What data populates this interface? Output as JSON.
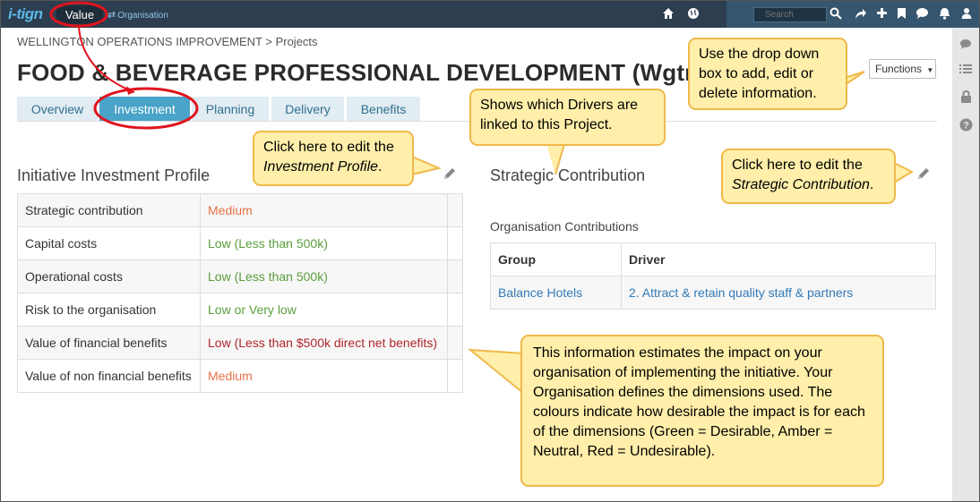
{
  "topbar": {
    "logo": "i-tign",
    "value_label": "Value",
    "organisation_label": "Organisation",
    "search_placeholder": "Search"
  },
  "breadcrumb": "WELLINGTON OPERATIONS IMPROVEMENT > Projects",
  "page_title": "FOOD & BEVERAGE PROFESSIONAL DEVELOPMENT (Wgtn)",
  "functions_label": "Functions",
  "tabs": [
    {
      "label": "Overview"
    },
    {
      "label": "Investment"
    },
    {
      "label": "Planning"
    },
    {
      "label": "Delivery"
    },
    {
      "label": "Benefits"
    }
  ],
  "investment": {
    "title": "Initiative Investment Profile",
    "rows": [
      {
        "label": "Strategic contribution",
        "value": "Medium",
        "color": "#e8734a"
      },
      {
        "label": "Capital costs",
        "value": "Low (Less than 500k)",
        "color": "#5a9e3c"
      },
      {
        "label": "Operational costs",
        "value": "Low (Less than 500k)",
        "color": "#5a9e3c"
      },
      {
        "label": "Risk to the organisation",
        "value": "Low or Very low",
        "color": "#5a9e3c"
      },
      {
        "label": "Value of financial benefits",
        "value": "Low (Less than $500k direct net benefits)",
        "color": "#b0262b"
      },
      {
        "label": "Value of non financial benefits",
        "value": "Medium",
        "color": "#e8734a"
      }
    ]
  },
  "strategic": {
    "title": "Strategic Contribution",
    "subtitle": "Organisation Contributions",
    "headers": {
      "group": "Group",
      "driver": "Driver"
    },
    "rows": [
      {
        "group": "Balance Hotels",
        "driver": "2. Attract & retain quality staff & partners"
      }
    ]
  },
  "callouts": {
    "dropdown": "Use the drop down box to add, edit or delete information.",
    "drivers": "Shows which Drivers are linked to this Project.",
    "investment_edit_prefix": "Click here to edit the",
    "investment_edit_italic": "Investment Profile",
    "strategic_edit_prefix": "Click here to edit the",
    "strategic_edit_italic": "Strategic Contribution",
    "estimates": "This information estimates the impact on your organisation of implementing the initiative. Your Organisation defines the dimensions used.  The colours indicate how desirable the impact is for each of the dimensions (Green = Desirable, Amber = Neutral, Red = Undesirable)."
  },
  "colors": {
    "topbar": "#2c3e50",
    "tab_active": "#4aa3c9",
    "callout_fill": "#ffefaa",
    "callout_border": "#f0b94a",
    "highlight_red": "#e0141e"
  },
  "icons": [
    "home-icon",
    "globe-icon",
    "search-icon",
    "share-icon",
    "plus-icon",
    "bookmark-icon",
    "comment-icon",
    "bell-icon",
    "user-icon",
    "chat-icon",
    "list-icon",
    "lock-icon",
    "help-icon",
    "pencil-icon",
    "exchange-icon",
    "caret-down-icon"
  ]
}
